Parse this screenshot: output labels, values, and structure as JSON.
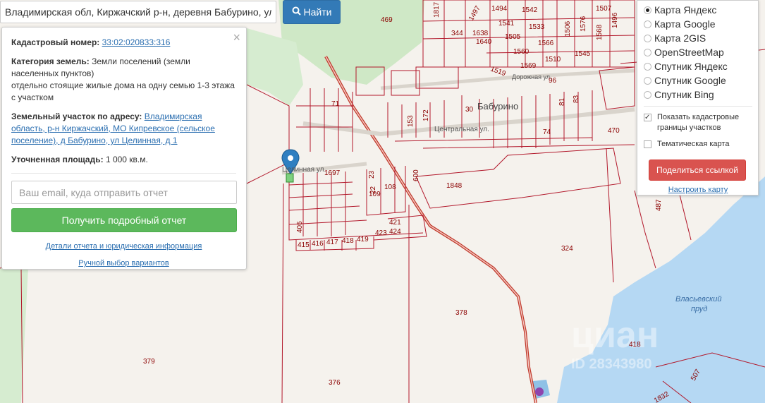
{
  "search": {
    "value": "Владимирская обл, Киржачский р-н, деревня Бабурино, ул",
    "button_label": "Найти"
  },
  "info": {
    "cadastral_label": "Кадастровый номер:",
    "cadastral_number": "33:02:020833:316",
    "category_label": "Категория земель:",
    "category_value": "Земли поселений (земли населенных пунктов)",
    "use_value": "отдельно стоящие жилые дома на одну семью 1-3 этажа с участком",
    "address_label": "Земельный участок по адресу:",
    "address_value": "Владимирская область, р-н Киржачский, МО Кипревское (сельское поселение), д Бабурино, ул Целинная, д 1",
    "area_label": "Уточненная площадь:",
    "area_value": "1 000 кв.м.",
    "email_placeholder": "Ваш email, куда отправить отчет",
    "report_button": "Получить подробный отчет",
    "details_link": "Детали отчета и юридическая информация",
    "manual_link": "Ручной выбор вариантов",
    "close_symbol": "×"
  },
  "layers": {
    "options": [
      {
        "label": "Карта Яндекс",
        "selected": true
      },
      {
        "label": "Карта Google",
        "selected": false
      },
      {
        "label": "Карта 2GIS",
        "selected": false
      },
      {
        "label": "OpenStreetMap",
        "selected": false
      },
      {
        "label": "Спутник Яндекс",
        "selected": false
      },
      {
        "label": "Спутник Google",
        "selected": false
      },
      {
        "label": "Спутник Bing",
        "selected": false
      }
    ],
    "show_borders_label": "Показать кадастровые границы участков",
    "show_borders_checked": true,
    "thematic_label": "Тематическая карта",
    "thematic_checked": false,
    "share_button": "Поделиться ссылкой",
    "configure_link": "Настроить карту"
  },
  "map": {
    "village": "Бабурино",
    "streets": [
      "Центральная ул.",
      "Целинная ул.",
      "Дорожная ул."
    ],
    "lake_name_1": "Власьевский",
    "lake_name_2": "пруд",
    "parcels": [
      "469",
      "1817",
      "344",
      "1638",
      "1640",
      "1497",
      "1494",
      "1541",
      "1542",
      "1505",
      "1533",
      "1560",
      "1566",
      "1569",
      "1510",
      "1506",
      "1576",
      "1507",
      "1568",
      "1496",
      "1545",
      "1519",
      "96",
      "71",
      "153",
      "172",
      "30",
      "81",
      "83",
      "74",
      "1697",
      "23",
      "22",
      "600",
      "109",
      "108",
      "1848",
      "405",
      "415",
      "416",
      "417",
      "418",
      "419",
      "421",
      "423",
      "424",
      "324",
      "378",
      "379",
      "376",
      "418",
      "470",
      "487",
      "507",
      "1832"
    ],
    "watermark": "циан",
    "watermark_id": "ID 28343980"
  },
  "colors": {
    "parcel": "#b2182b",
    "road": "#c0392b",
    "forest": "#cfe8c6",
    "water": "#b5d8f3",
    "primary": "#337ab7",
    "success": "#5cb85c",
    "danger": "#d9534f"
  }
}
